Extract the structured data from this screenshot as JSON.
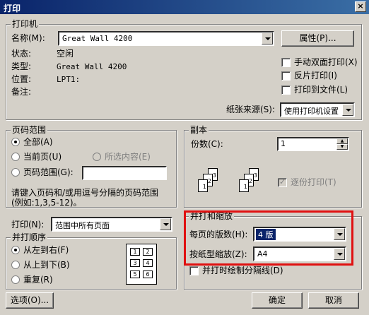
{
  "window": {
    "title": "打印",
    "close_label": "×"
  },
  "printer": {
    "group_label": "打印机",
    "name_label": "名称(M):",
    "name_value": "Great Wall 4200",
    "properties_button": "属性(P)...",
    "status_label": "状态:",
    "status_value": "空闲",
    "type_label": "类型:",
    "type_value": "Great Wall 4200",
    "location_label": "位置:",
    "location_value": "LPT1:",
    "comment_label": "备注:",
    "manual_duplex": "手动双面打印(X)",
    "reverse_print": "反片打印(I)",
    "print_to_file": "打印到文件(L)",
    "paper_source_label": "纸张来源(S):",
    "paper_source_value": "使用打印机设置"
  },
  "page_range": {
    "group_label": "页码范围",
    "all": "全部(A)",
    "current_page": "当前页(U)",
    "selection": "所选内容(E)",
    "pages": "页码范围(G):",
    "pages_value": "",
    "hint": "请键入页码和/或用逗号分隔的页码范围(例如:1,3,5-12)。"
  },
  "copies": {
    "group_label": "副本",
    "count_label": "份数(C):",
    "count_value": "1",
    "collate": "逐份打印(T)"
  },
  "print_what": {
    "label": "打印(N):",
    "value": "范围中所有页面"
  },
  "print_order": {
    "group_label": "并打顺序",
    "left_to_right": "从左到右(F)",
    "top_to_bottom": "从上到下(B)",
    "repeat": "重复(R)"
  },
  "zoom": {
    "group_label": "并打和缩放",
    "pages_per_sheet_label": "每页的版数(H):",
    "pages_per_sheet_value": "4 版",
    "scale_label": "按纸型缩放(Z):",
    "scale_value": "A4",
    "draw_borders": "并打时绘制分隔线(D)"
  },
  "footer": {
    "options_button": "选项(O)...",
    "ok_button": "确定",
    "cancel_button": "取消"
  },
  "order_icon_cells": [
    "1",
    "2",
    "3",
    "4",
    "5",
    "6"
  ],
  "collate_pages": [
    "1",
    "2",
    "3",
    "1",
    "2",
    "3"
  ],
  "colors": {
    "highlight": "#e01010",
    "title_bar": "#0a246a",
    "face": "#d4d0c8"
  }
}
